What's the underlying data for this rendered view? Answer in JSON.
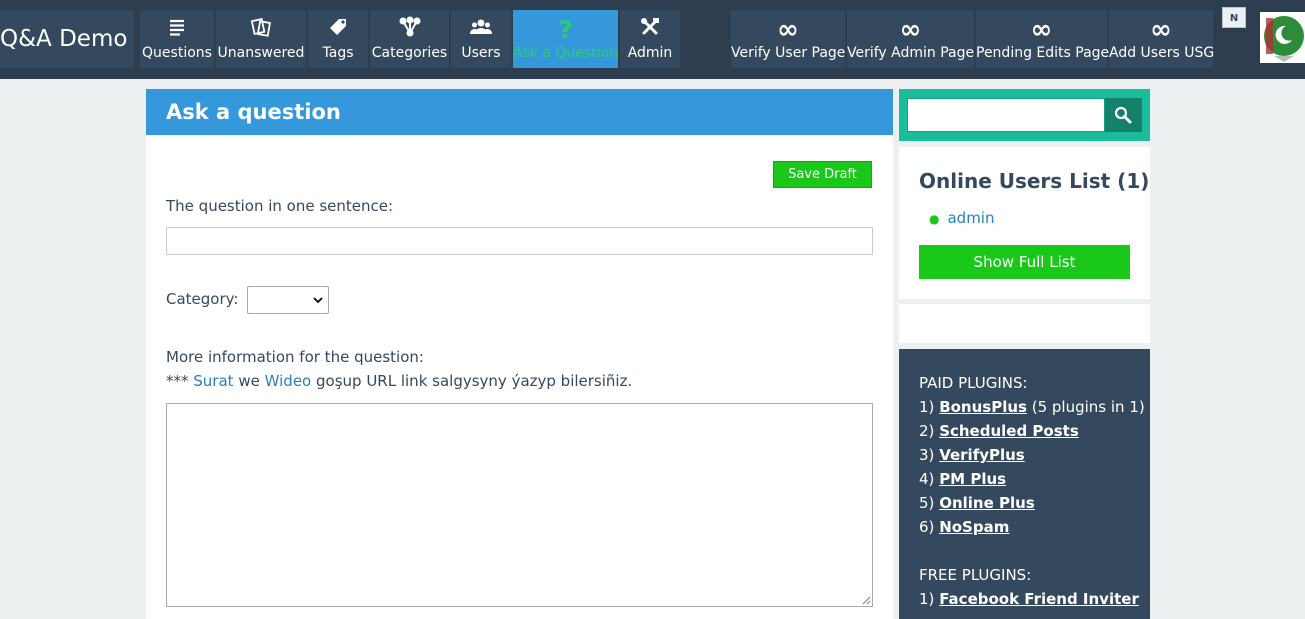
{
  "app": {
    "title": "Q&A Demo"
  },
  "nav": {
    "items": [
      {
        "label": "Questions",
        "icon": "list-icon"
      },
      {
        "label": "Unanswered",
        "icon": "cards-icon"
      },
      {
        "label": "Tags",
        "icon": "tag-icon"
      },
      {
        "label": "Categories",
        "icon": "sitemap-icon"
      },
      {
        "label": "Users",
        "icon": "users-icon"
      },
      {
        "label": "Ask a Question",
        "icon": "question-icon",
        "active": true
      },
      {
        "label": "Admin",
        "icon": "tools-icon"
      }
    ],
    "extra": [
      {
        "label": "Verify User Page",
        "icon": "infinity-icon"
      },
      {
        "label": "Verify Admin Page",
        "icon": "infinity-icon"
      },
      {
        "label": "Pending Edits Page",
        "icon": "infinity-icon"
      },
      {
        "label": "Add Users USG",
        "icon": "infinity-icon"
      }
    ],
    "badge": "N",
    "infinity_glyph": "∞"
  },
  "ask": {
    "heading": "Ask a question",
    "save_draft": "Save Draft",
    "title_label": "The question in one sentence:",
    "title_value": "",
    "category_label": "Category:",
    "category_value": "",
    "more_info_label": "More information for the question:",
    "hint_prefix": "***",
    "hint_link1": "Surat",
    "hint_mid": "we",
    "hint_link2": "Wideo",
    "hint_suffix": "goşup URL link salgysyny ýazyp bilersiñiz.",
    "body_value": ""
  },
  "sidebar": {
    "search_value": "",
    "online_title": "Online Users List (1)",
    "online_users": [
      "admin"
    ],
    "full_list_button": "Show Full List",
    "paid_title": "PAID PLUGINS:",
    "paid": [
      {
        "num": "1)",
        "name": "BonusPlus",
        "note": "(5 plugins in 1)"
      },
      {
        "num": "2)",
        "name": "Scheduled Posts",
        "note": ""
      },
      {
        "num": "3)",
        "name": "VerifyPlus",
        "note": ""
      },
      {
        "num": "4)",
        "name": "PM Plus",
        "note": ""
      },
      {
        "num": "5)",
        "name": "Online Plus",
        "note": ""
      },
      {
        "num": "6)",
        "name": "NoSpam",
        "note": ""
      }
    ],
    "free_title": "FREE PLUGINS:",
    "free": [
      {
        "num": "1)",
        "name": "Facebook Friend Inviter"
      }
    ]
  },
  "colors": {
    "topbar": "#2c3e50",
    "nav_item": "#34495e",
    "active_nav": "#3498db",
    "header_blue": "#3498db",
    "green_button": "#1ac81a",
    "search_teal": "#1abc9c"
  }
}
